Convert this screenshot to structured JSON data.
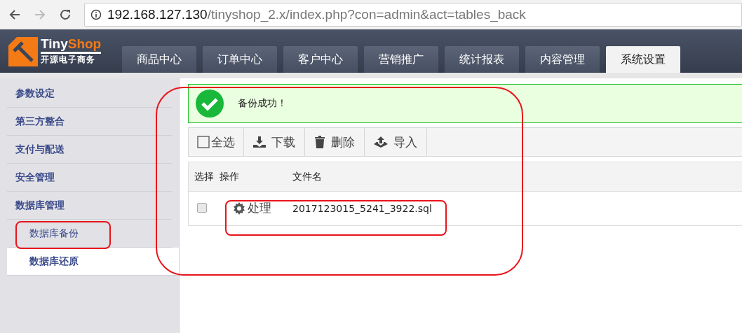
{
  "browser": {
    "url_host": "192.168.127.130",
    "url_path": "/tinyshop_2.x/index.php?con=admin&act=tables_back"
  },
  "logo": {
    "name_first": "Tiny",
    "name_second": "Shop",
    "tagline": "开源电子商务"
  },
  "tabs": [
    {
      "label": "商品中心",
      "selected": false
    },
    {
      "label": "订单中心",
      "selected": false
    },
    {
      "label": "客户中心",
      "selected": false
    },
    {
      "label": "营销推广",
      "selected": false
    },
    {
      "label": "统计报表",
      "selected": false
    },
    {
      "label": "内容管理",
      "selected": false
    },
    {
      "label": "系统设置",
      "selected": true
    }
  ],
  "sidebar": {
    "items": [
      {
        "label": "参数设定",
        "selected": false
      },
      {
        "label": "第三方整合",
        "selected": false
      },
      {
        "label": "支付与配送",
        "selected": false
      },
      {
        "label": "安全管理",
        "selected": false
      },
      {
        "label": "数据库管理",
        "selected": false,
        "children": [
          {
            "label": "数据库备份",
            "selected": false
          },
          {
            "label": "数据库还原",
            "selected": true
          }
        ]
      }
    ]
  },
  "alert": {
    "message": "备份成功！"
  },
  "toolbar": [
    {
      "label": "全选",
      "kind": "select"
    },
    {
      "label": "下载",
      "kind": "download"
    },
    {
      "label": "删除",
      "kind": "delete"
    },
    {
      "label": "导入",
      "kind": "import"
    }
  ],
  "table": {
    "columns": [
      "选择",
      "操作",
      "文件名"
    ],
    "rows": [
      {
        "checked": false,
        "action": "处理",
        "filename": "2017123015_5241_3922.sql"
      }
    ]
  }
}
